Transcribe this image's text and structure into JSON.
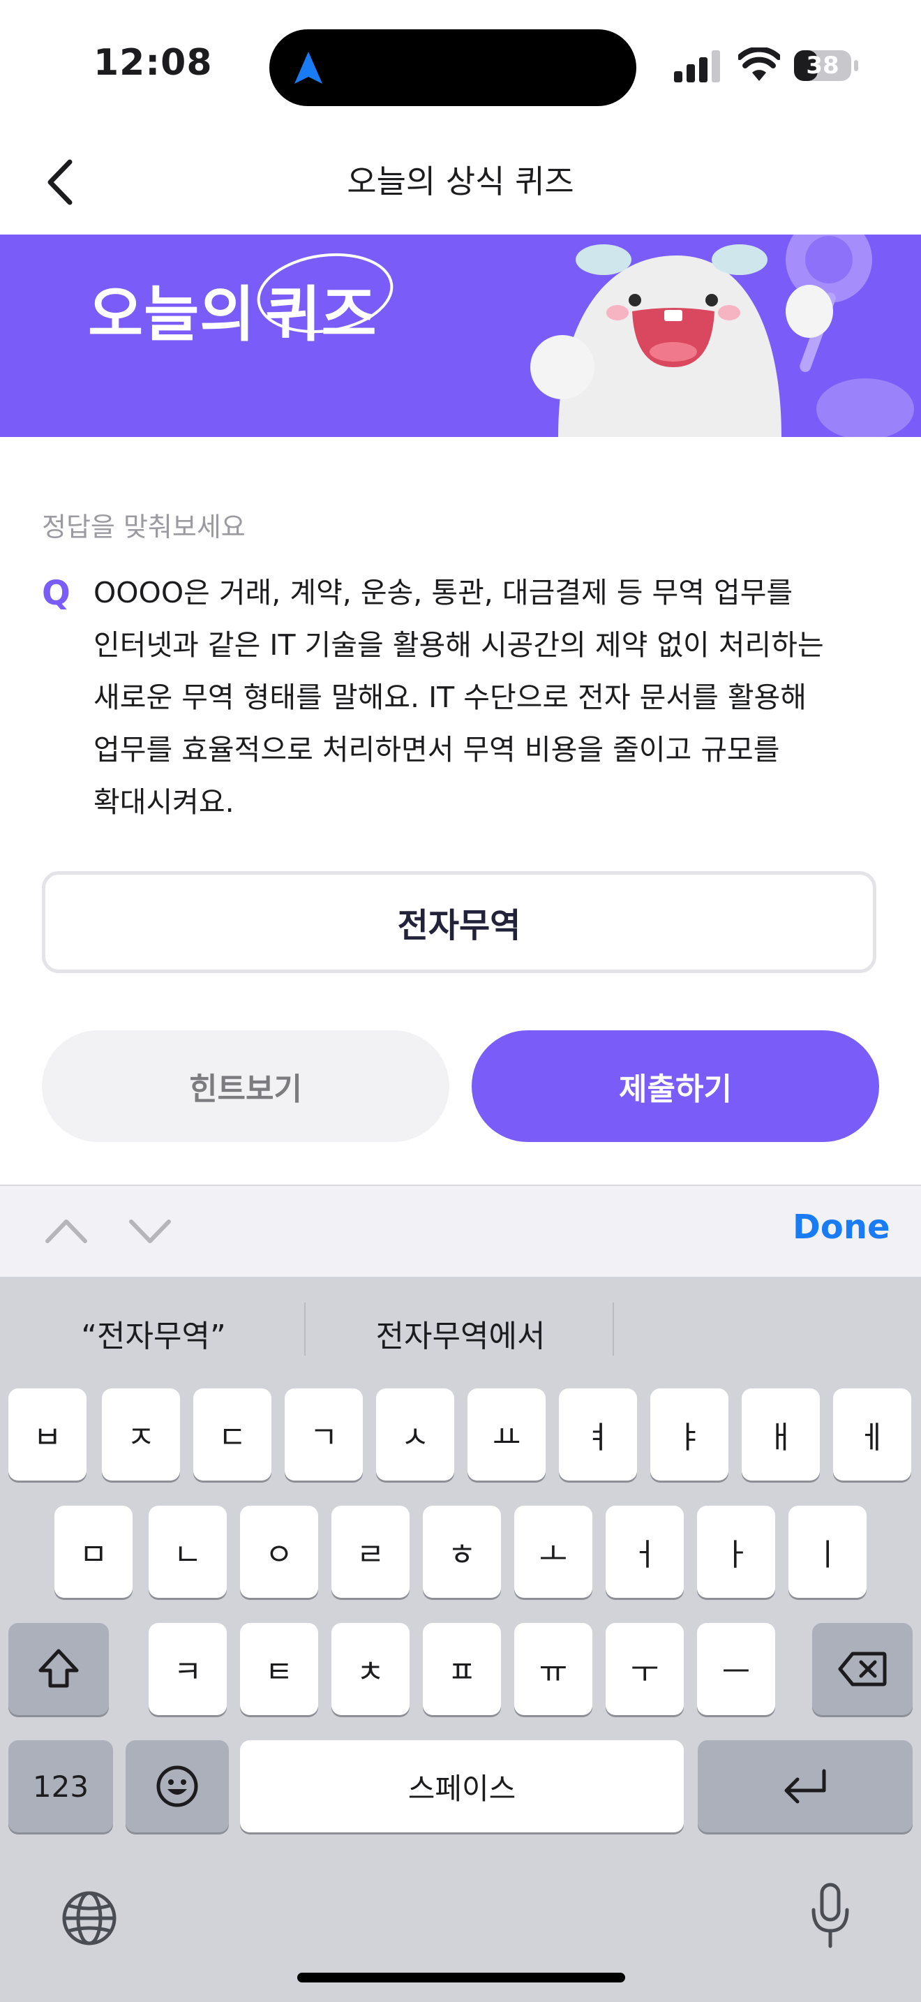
{
  "status_bar": {
    "time": "12:08",
    "battery": "38"
  },
  "nav": {
    "title": "오늘의 상식 퀴즈"
  },
  "banner": {
    "title_prefix": "오늘의",
    "title_highlight": "퀴즈"
  },
  "quiz": {
    "instruction": "정답을 맞춰보세요",
    "q_mark": "Q",
    "question": "OOOO은 거래, 계약, 운송, 통관, 대금결제 등 무역 업무를 인터넷과 같은 IT 기술을 활용해 시공간의 제약 없이 처리하는 새로운 무역 형태를 말해요. IT 수단으로 전자 문서를 활용해 업무를 효율적으로 처리하면서 무역 비용을 줄이고 규모를 확대시켜요.",
    "answer_value": "전자무역",
    "hint_label": "힌트보기",
    "submit_label": "제출하기"
  },
  "accessory": {
    "done_label": "Done"
  },
  "keyboard": {
    "suggestions": [
      "“전자무역”",
      "전자무역에서"
    ],
    "row1": [
      "ㅂ",
      "ㅈ",
      "ㄷ",
      "ㄱ",
      "ㅅ",
      "ㅛ",
      "ㅕ",
      "ㅑ",
      "ㅐ",
      "ㅔ"
    ],
    "row2": [
      "ㅁ",
      "ㄴ",
      "ㅇ",
      "ㄹ",
      "ㅎ",
      "ㅗ",
      "ㅓ",
      "ㅏ",
      "ㅣ"
    ],
    "row3": [
      "ㅋ",
      "ㅌ",
      "ㅊ",
      "ㅍ",
      "ㅠ",
      "ㅜ",
      "ㅡ"
    ],
    "numbers_label": "123",
    "space_label": "스페이스"
  },
  "colors": {
    "accent": "#7a5cf8",
    "done_blue": "#1a7cf5",
    "keyboard_bg": "#d1d3d9"
  }
}
